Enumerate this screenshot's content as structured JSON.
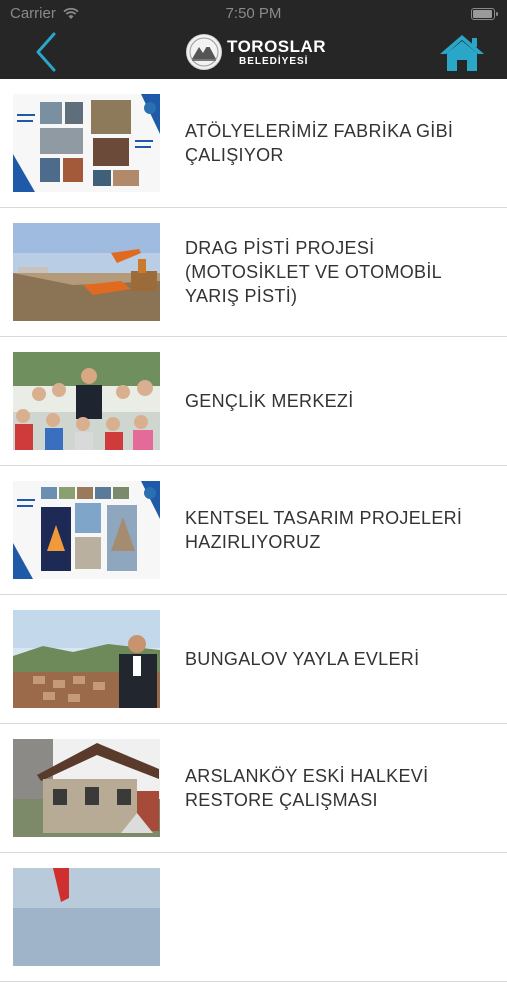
{
  "status_bar": {
    "carrier": "Carrier",
    "time": "7:50 PM",
    "battery_level": 0.95
  },
  "header": {
    "back_icon": "chevron-left-icon",
    "logo_line1": "TOROSLAR",
    "logo_line2": "BELEDİYESİ",
    "home_icon": "home-icon",
    "accent_color": "#2aa7c8",
    "bar_color": "#262626"
  },
  "items": [
    {
      "title": "ATÖLYELERİMİZ FABRİKA GİBİ ÇALIŞIYOR"
    },
    {
      "title": "DRAG PİSTİ PROJESİ (MOTOSİKLET VE OTOMOBİL YARIŞ PİSTİ)"
    },
    {
      "title": "GENÇLİK MERKEZİ"
    },
    {
      "title": "KENTSEL TASARIM PROJELERİ HAZIRLIYORUZ"
    },
    {
      "title": "BUNGALOV YAYLA EVLERİ"
    },
    {
      "title": "ARSLANKÖY ESKİ HALKEVİ RESTORE ÇALIŞMASI"
    },
    {
      "title": ""
    }
  ]
}
